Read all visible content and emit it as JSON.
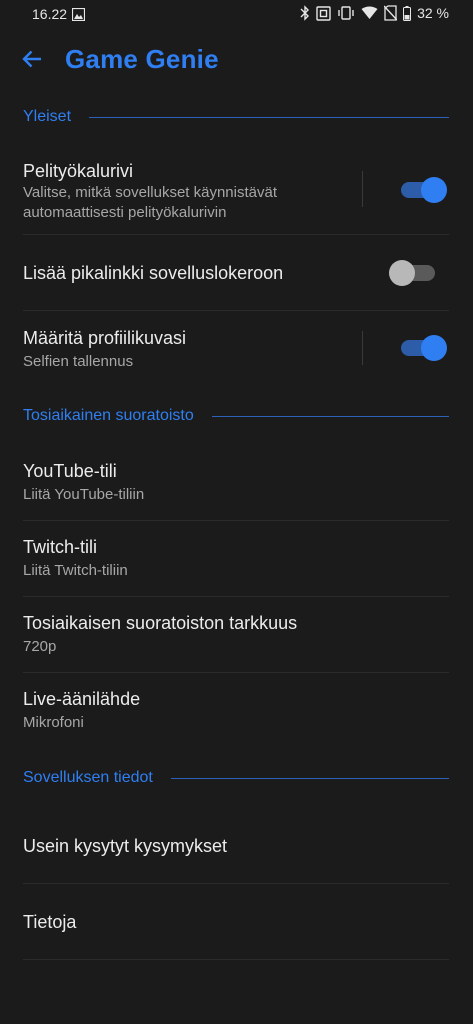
{
  "status_bar": {
    "time": "16.22",
    "battery": "32 %",
    "icons": [
      "gallery-icon",
      "bluetooth-icon",
      "nfc-icon",
      "vibrate-icon",
      "wifi-icon",
      "no-sim-icon",
      "battery-icon"
    ]
  },
  "header": {
    "title": "Game Genie",
    "back_icon": "arrow-back-icon"
  },
  "sections": {
    "general": {
      "label": "Yleiset",
      "items": {
        "game_toolbar": {
          "title": "Pelityökalurivi",
          "subtitle_1": "Valitse, mitkä sovellukset käynnistävät",
          "subtitle_2": "automaattisesti pelityökalurivin",
          "enabled": true
        },
        "shortcut": {
          "title": "Lisää pikalinkki sovelluslokeroon",
          "enabled": false
        },
        "profile_picture": {
          "title": "Määritä profiilikuvasi",
          "subtitle": "Selfien tallennus",
          "enabled": true
        }
      }
    },
    "live_streaming": {
      "label": "Tosiaikainen suoratoisto",
      "items": {
        "youtube": {
          "title": "YouTube-tili",
          "subtitle": "Liitä YouTube-tiliin"
        },
        "twitch": {
          "title": "Twitch-tili",
          "subtitle": "Liitä Twitch-tiliin"
        },
        "resolution": {
          "title": "Tosiaikaisen suoratoiston tarkkuus",
          "subtitle": "720p"
        },
        "audio": {
          "title": "Live-äänilähde",
          "subtitle": "Mikrofoni"
        }
      }
    },
    "app_info": {
      "label": "Sovelluksen tiedot",
      "items": {
        "faq": {
          "title": "Usein kysytyt kysymykset"
        },
        "about": {
          "title": "Tietoja"
        }
      }
    }
  },
  "colors": {
    "background": "#1b1b1b",
    "accent": "#2f7ff2",
    "text_primary": "#ececec",
    "text_secondary": "#a7a7a7"
  }
}
